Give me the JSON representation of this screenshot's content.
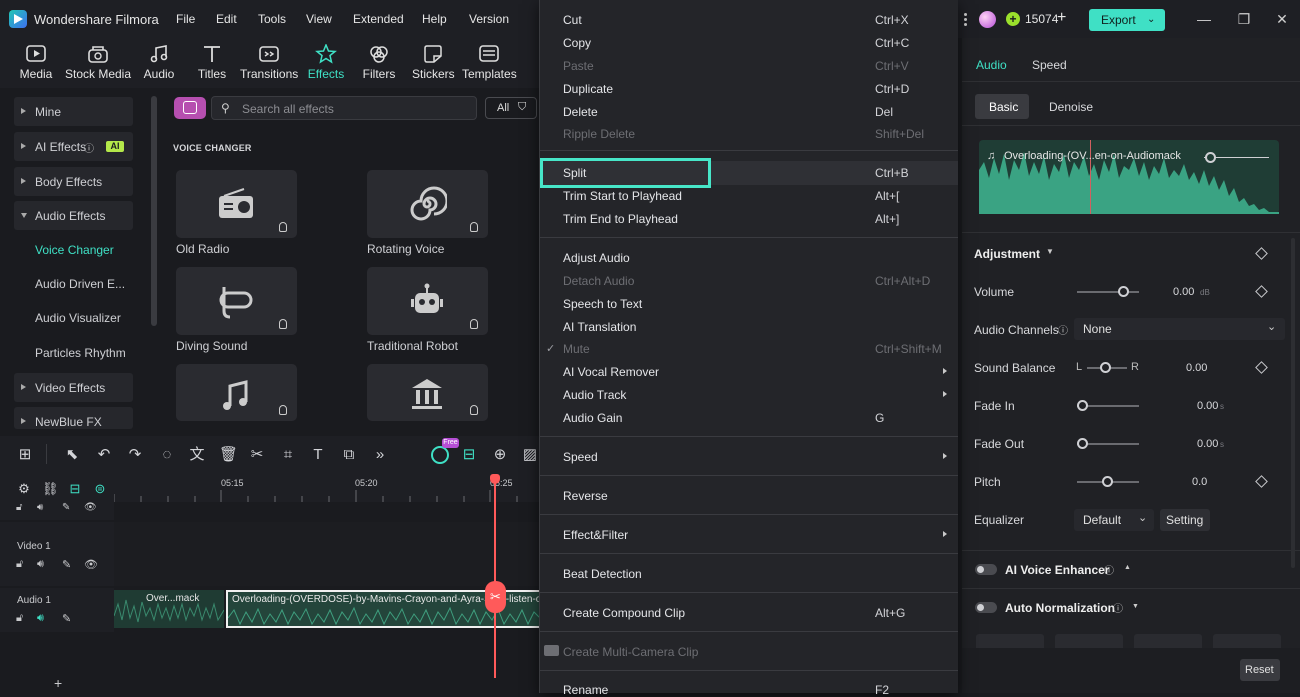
{
  "app": {
    "name": "Wondershare Filmora"
  },
  "menubar": [
    "File",
    "Edit",
    "Tools",
    "View",
    "Extended",
    "Help",
    "Version"
  ],
  "top_right": {
    "credits": "15074",
    "export_label": "Export"
  },
  "media_tools": [
    {
      "label": "Media",
      "icon": "media-icon"
    },
    {
      "label": "Stock Media",
      "icon": "stock-media-icon"
    },
    {
      "label": "Audio",
      "icon": "audio-icon"
    },
    {
      "label": "Titles",
      "icon": "titles-icon"
    },
    {
      "label": "Transitions",
      "icon": "transitions-icon"
    },
    {
      "label": "Effects",
      "icon": "effects-icon",
      "active": true
    },
    {
      "label": "Filters",
      "icon": "filters-icon"
    },
    {
      "label": "Stickers",
      "icon": "stickers-icon"
    },
    {
      "label": "Templates",
      "icon": "templates-icon"
    }
  ],
  "sidebar": {
    "groups": [
      "Mine",
      "AI Effects",
      "Body Effects",
      "Audio Effects",
      "Video Effects",
      "NewBlue FX"
    ],
    "ai_badge": "AI",
    "audio_sub": [
      "Voice Changer",
      "Audio Driven E...",
      "Audio Visualizer",
      "Particles Rhythm"
    ]
  },
  "effects": {
    "search_placeholder": "Search all effects",
    "filter_all": "All",
    "section_title": "VOICE CHANGER",
    "items": [
      "Old Radio",
      "Rotating Voice",
      "Diving Sound",
      "Traditional Robot",
      "",
      ""
    ]
  },
  "timeline": {
    "ruler": [
      "05:15",
      "05:20",
      "05:25"
    ],
    "tracks": [
      "Video 1",
      "Audio 1"
    ],
    "clip_short": "Over...mack",
    "clip_long": "Overloading-(OVERDOSE)-by-Mavins-Crayon-and-Ayra-Starr-listen-on",
    "free_badge": "Free"
  },
  "context_menu": [
    {
      "label": "Cut",
      "shortcut": "Ctrl+X"
    },
    {
      "label": "Copy",
      "shortcut": "Ctrl+C"
    },
    {
      "label": "Paste",
      "shortcut": "Ctrl+V",
      "disabled": true
    },
    {
      "label": "Duplicate",
      "shortcut": "Ctrl+D"
    },
    {
      "label": "Delete",
      "shortcut": "Del"
    },
    {
      "label": "Ripple Delete",
      "shortcut": "Shift+Del",
      "disabled": true
    },
    {
      "label": "Split",
      "shortcut": "Ctrl+B",
      "highlighted": true
    },
    {
      "label": "Trim Start to Playhead",
      "shortcut": "Alt+["
    },
    {
      "label": "Trim End to Playhead",
      "shortcut": "Alt+]"
    },
    {
      "label": "Adjust Audio",
      "shortcut": ""
    },
    {
      "label": "Detach Audio",
      "shortcut": "Ctrl+Alt+D",
      "disabled": true
    },
    {
      "label": "Speech to Text",
      "shortcut": ""
    },
    {
      "label": "AI Translation",
      "shortcut": ""
    },
    {
      "label": "Mute",
      "shortcut": "Ctrl+Shift+M",
      "disabled": true,
      "checked": true
    },
    {
      "label": "AI Vocal Remover",
      "shortcut": "",
      "submenu": true
    },
    {
      "label": "Audio Track",
      "shortcut": "",
      "submenu": true
    },
    {
      "label": "Audio Gain",
      "shortcut": "G"
    },
    {
      "label": "Speed",
      "shortcut": "",
      "submenu": true
    },
    {
      "label": "Reverse",
      "shortcut": ""
    },
    {
      "label": "Effect&Filter",
      "shortcut": "",
      "submenu": true
    },
    {
      "label": "Beat Detection",
      "shortcut": ""
    },
    {
      "label": "Create Compound Clip",
      "shortcut": "Alt+G"
    },
    {
      "label": "Create Multi-Camera Clip",
      "shortcut": "",
      "disabled": true
    },
    {
      "label": "Rename",
      "shortcut": "F2"
    }
  ],
  "right_panel": {
    "tabs": [
      "Audio",
      "Speed"
    ],
    "subtabs": [
      "Basic",
      "Denoise"
    ],
    "waveform_title": "Overloading-(OV...en-on-Audiomack",
    "adjustment": "Adjustment",
    "volume": {
      "label": "Volume",
      "value": "0.00",
      "unit": "dB"
    },
    "channels": {
      "label": "Audio Channels",
      "value": "None"
    },
    "balance": {
      "label": "Sound Balance",
      "l": "L",
      "r": "R",
      "value": "0.00"
    },
    "fade_in": {
      "label": "Fade In",
      "value": "0.00",
      "unit": "s"
    },
    "fade_out": {
      "label": "Fade Out",
      "value": "0.00",
      "unit": "s"
    },
    "pitch": {
      "label": "Pitch",
      "value": "0.0"
    },
    "equalizer": {
      "label": "Equalizer",
      "value": "Default",
      "setting": "Setting"
    },
    "ai_voice": "AI Voice Enhancer",
    "auto_norm": "Auto Normalization",
    "reset": "Reset"
  },
  "colors": {
    "accent": "#3fe0c5",
    "playhead": "#ff5a5a",
    "highlight": "#47e6c8"
  }
}
